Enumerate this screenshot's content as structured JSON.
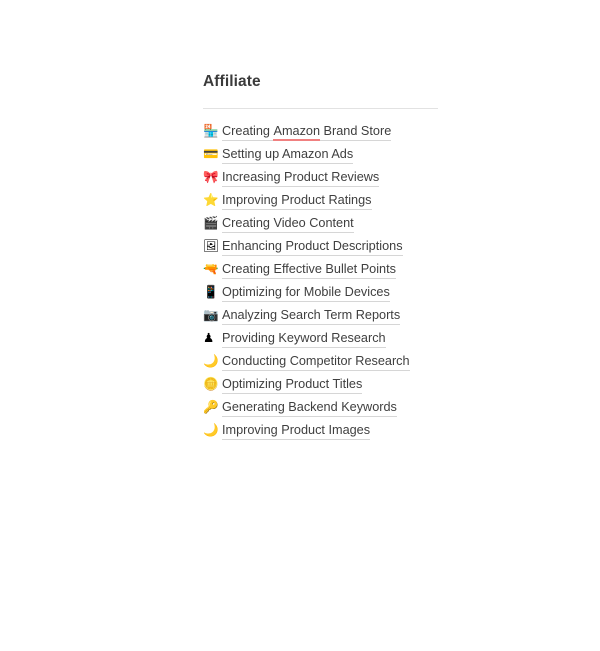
{
  "section": {
    "title": "Affiliate"
  },
  "highlight": {
    "term": "Amazon",
    "color": "#f08080"
  },
  "links": [
    {
      "icon": "🏪",
      "icon_name": "convenience-store-icon",
      "text_before": "Creating ",
      "highlight": "Amazon",
      "text_after": " Brand Store",
      "full_text": "Creating Amazon Brand Store"
    },
    {
      "icon": "💳",
      "icon_name": "credit-card-icon",
      "full_text": "Setting up Amazon Ads"
    },
    {
      "icon": "🎀",
      "icon_name": "ribbon-icon",
      "full_text": "Increasing Product Reviews"
    },
    {
      "icon": "⭐",
      "icon_name": "star-icon",
      "full_text": "Improving Product Ratings"
    },
    {
      "icon": "🎬",
      "icon_name": "clapper-board-icon",
      "full_text": "Creating Video Content"
    },
    {
      "icon": "🖼",
      "icon_name": "framed-picture-icon",
      "full_text": "Enhancing Product Descriptions"
    },
    {
      "icon": "🔫",
      "icon_name": "water-pistol-icon",
      "full_text": "Creating Effective Bullet Points"
    },
    {
      "icon": "📱",
      "icon_name": "mobile-phone-icon",
      "full_text": "Optimizing for Mobile Devices"
    },
    {
      "icon": "📷",
      "icon_name": "camera-icon",
      "full_text": "Analyzing Search Term Reports"
    },
    {
      "icon": "♟",
      "icon_name": "chess-pawn-icon",
      "full_text": "Providing Keyword Research"
    },
    {
      "icon": "🌙",
      "icon_name": "crescent-moon-icon",
      "full_text": "Conducting Competitor Research"
    },
    {
      "icon": "🪙",
      "icon_name": "coin-icon",
      "full_text": "Optimizing Product Titles"
    },
    {
      "icon": "🔑",
      "icon_name": "key-icon",
      "full_text": "Generating Backend Keywords"
    },
    {
      "icon": "🌙",
      "icon_name": "crescent-moon-icon",
      "full_text": "Improving Product Images"
    }
  ]
}
